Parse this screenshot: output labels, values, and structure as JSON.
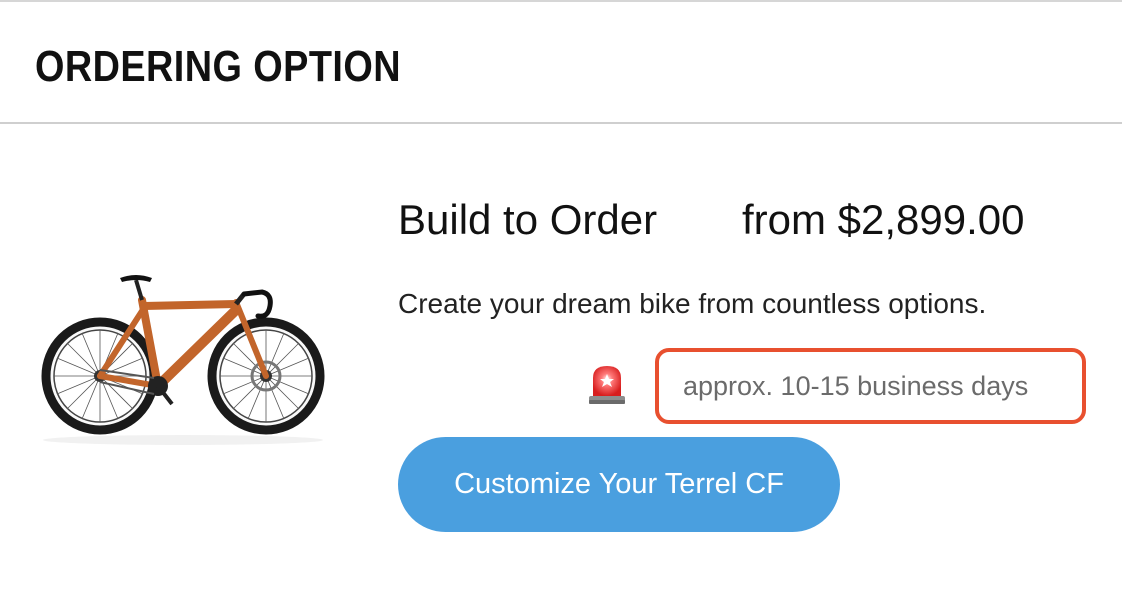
{
  "header": {
    "title": "ORDERING OPTION"
  },
  "option": {
    "name": "Build to Order",
    "price": "from $2,899.00",
    "description": "Create your dream bike from countless options.",
    "lead_time": "approx. 10-15 business days",
    "lead_time_icon": "siren-icon",
    "button_label": "Customize Your Terrel CF"
  },
  "product": {
    "image_alt": "Terrel CF gravel bike"
  },
  "colors": {
    "button": "#4a9fdf",
    "highlight_border": "#e8502f",
    "bike_frame": "#c2652b"
  }
}
